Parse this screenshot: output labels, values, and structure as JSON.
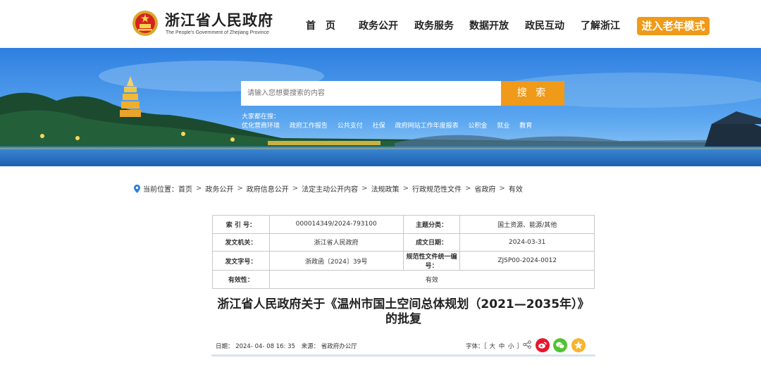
{
  "header": {
    "site_title": "浙江省人民政府",
    "site_subtitle": "The People's Government of Zhejiang Province",
    "nav": [
      "首　页",
      "政务公开",
      "政务服务",
      "数据开放",
      "政民互动",
      "了解浙江"
    ],
    "elder_mode": "进入老年模式"
  },
  "banner": {
    "search_placeholder": "请输入您想要搜索的内容",
    "search_button": "搜 索",
    "hot_label": "大家都在搜：",
    "hot_links": [
      "优化营商环境",
      "政府工作报告",
      "公共支付",
      "社保",
      "政府网站工作年度报表",
      "公积金",
      "就业",
      "教育"
    ]
  },
  "breadcrumb": {
    "label": "当前位置：",
    "items": [
      "首页",
      "政务公开",
      "政府信息公开",
      "法定主动公开内容",
      "法规政策",
      "行政规范性文件",
      "省政府",
      "有效"
    ]
  },
  "info": {
    "index_k": "索 引 号：",
    "index_v": "000014349/2024-793100",
    "topic_k": "主题分类：",
    "topic_v": "国土资源、能源/其他",
    "org_k": "发文机关：",
    "org_v": "浙江省人民政府",
    "date_k": "成文日期：",
    "date_v": "2024-03-31",
    "docno_k": "发文字号：",
    "docno_v": "浙政函〔2024〕39号",
    "code_k": "规范性文件统一编号：",
    "code_v": "ZJSP00-2024-0012",
    "valid_k": "有效性：",
    "valid_v": "有效"
  },
  "doc": {
    "title": "浙江省人民政府关于《温州市国土空间总体规划（2021—2035年）》的批复",
    "date": "日期：  2024- 04- 08 16: 35",
    "source": "来源：  省政府办公厅",
    "font_label": "字体：［",
    "font_large": "大",
    "font_mid": "中",
    "font_small": "小",
    "font_end": "］"
  },
  "colors": {
    "accent": "#f09a1a",
    "weibo": "#e6162d",
    "wechat": "#51c332",
    "fav": "#f7b52c"
  }
}
